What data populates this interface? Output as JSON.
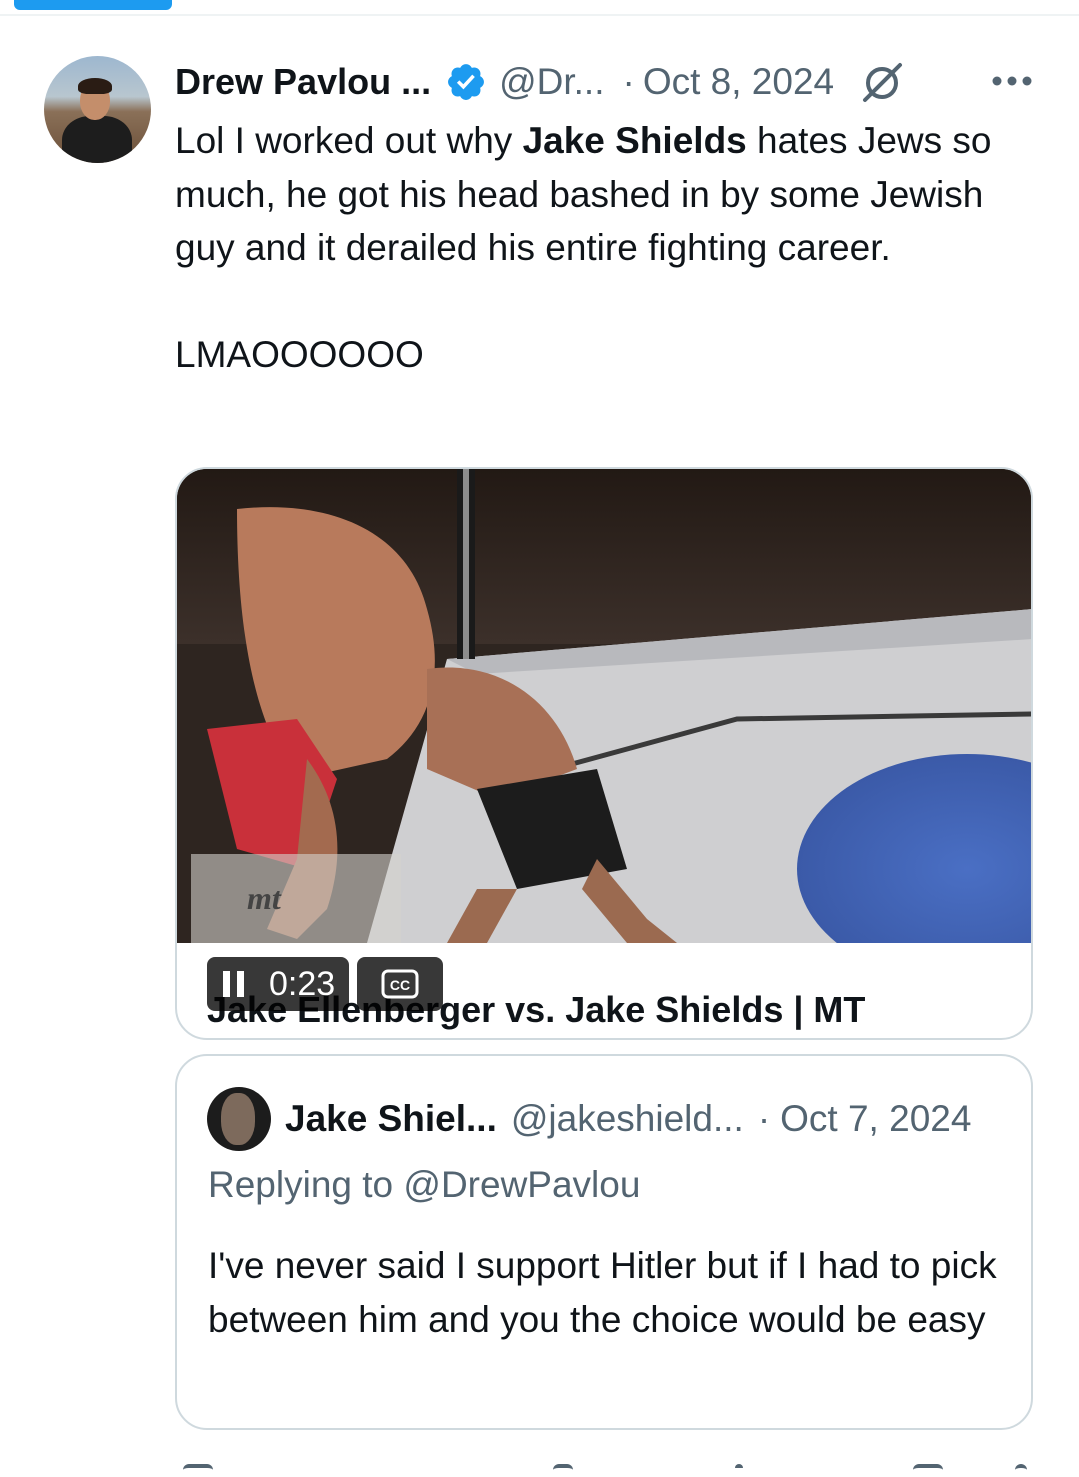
{
  "tweet": {
    "author_name": "Drew Pavlou ...",
    "handle": "@Dr...",
    "separator": "·",
    "date": "Oct 8, 2024",
    "text_before": "Lol I worked out why ",
    "text_bold": "Jake Shields",
    "text_after": " hates Jews so much, he got his head bashed in by some Jewish guy and it derailed his entire fighting career.",
    "text_second": "LMAOOOOOO"
  },
  "media": {
    "time": "0:23",
    "cc_label": "CC",
    "title": "Jake Ellenberger vs. Jake Shields | MT",
    "watermark": "mt"
  },
  "quote": {
    "author_name": "Jake Shiel...",
    "handle": "@jakeshield...",
    "separator": "·",
    "date": "Oct 7, 2024",
    "replying_to": "Replying to @DrewPavlou",
    "text": "I've never said I support Hitler but if I had to pick between him and you the choice would be easy"
  },
  "colors": {
    "accent": "#1d9bf0",
    "secondary_text": "#536471",
    "border": "#cfd9de"
  },
  "icons": {
    "verified": "verified-badge-icon",
    "grok": "grok-icon",
    "more": "more-dots-icon",
    "pause": "pause-icon",
    "captions": "closed-captions-icon"
  }
}
